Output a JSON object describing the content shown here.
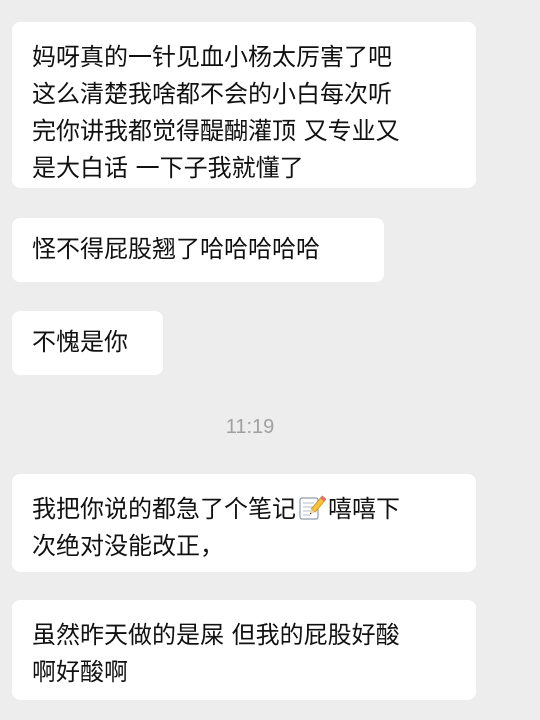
{
  "messages": [
    {
      "lines": [
        "妈呀真的一针见血小杨太厉害了吧",
        "这么清楚我啥都不会的小白每次听",
        "完你讲我都觉得醍醐灌顶 又专业又",
        "是大白话 一下子我就懂了"
      ]
    },
    {
      "lines": [
        "怪不得屁股翘了哈哈哈哈哈"
      ]
    },
    {
      "lines": [
        "不愧是你"
      ]
    },
    {
      "line1_before_emoji": "我把你说的都急了个笔记",
      "emoji": "memo-icon",
      "line1_after_emoji": "嘻嘻下",
      "line2": "次绝对没能改正，"
    },
    {
      "lines": [
        "虽然昨天做的是屎 但我的屁股好酸",
        "啊好酸啊"
      ]
    }
  ],
  "timestamp": "11:19"
}
